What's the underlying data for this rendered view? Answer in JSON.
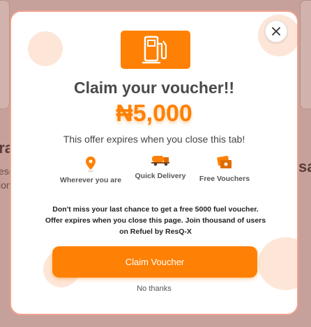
{
  "background": {
    "left_heading": "era",
    "left_sub_1": "ese",
    "left_sub_2": "ion",
    "right_heading": "sa"
  },
  "modal": {
    "title": "Claim your voucher!!",
    "amount": "₦5,000",
    "expires_text": "This offer expires when you close this tab!",
    "features": [
      {
        "icon": "location-pin-icon",
        "label": "Wherever you are"
      },
      {
        "icon": "fuel-truck-icon",
        "label": "Quick Delivery"
      },
      {
        "icon": "voucher-icon",
        "label": "Free Vouchers"
      }
    ],
    "message_lines": [
      "Don't miss your last chance to get a free 5000 fuel voucher.",
      "Offer expires when you close this page. Join thousand of users",
      "on Refuel by ResQ-X"
    ],
    "claim_button": "Claim Voucher",
    "no_thanks": "No thanks",
    "close_icon": "close-icon",
    "header_icon": "fuel-pump-icon"
  },
  "colors": {
    "accent": "#fe8105",
    "backdrop": "#c6a19b",
    "title_text": "#4a4a4a"
  }
}
